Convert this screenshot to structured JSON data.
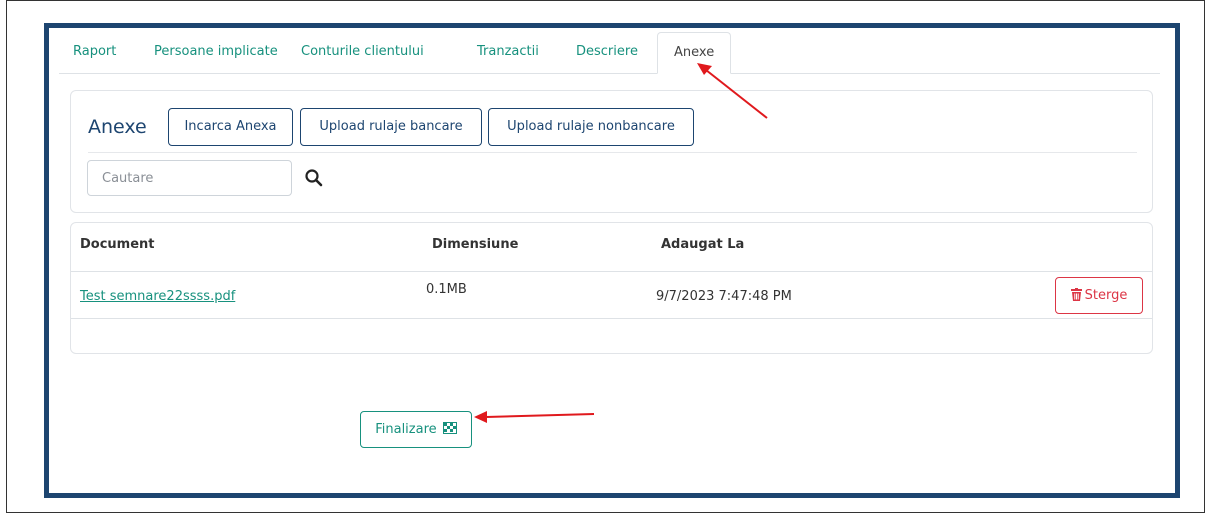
{
  "tabs": [
    {
      "label": "Raport",
      "active": false
    },
    {
      "label": "Persoane implicate",
      "active": false
    },
    {
      "label": "Conturile clientului",
      "active": false
    },
    {
      "label": "Tranzactii",
      "active": false
    },
    {
      "label": "Descriere",
      "active": false
    },
    {
      "label": "Anexe",
      "active": true
    }
  ],
  "anexe": {
    "title": "Anexe",
    "buttons": {
      "incarca": "Incarca Anexa",
      "upload_bancare": "Upload rulaje bancare",
      "upload_nonbancare": "Upload rulaje nonbancare"
    },
    "search": {
      "placeholder": "Cautare",
      "value": ""
    }
  },
  "table": {
    "headers": [
      "Document",
      "Dimensiune",
      "Adaugat La"
    ],
    "rows": [
      {
        "document": "Test semnare22ssss.pdf",
        "size": "0.1MB",
        "added": "9/7/2023 7:47:48 PM",
        "delete_label": "Sterge"
      }
    ]
  },
  "finalize": {
    "label": "Finalizare"
  },
  "colors": {
    "frame": "#1d4570",
    "accent": "#17917e",
    "danger": "#dc3545",
    "annotation_arrow": "#e0191d"
  },
  "icons": [
    "search-icon",
    "trash-icon",
    "checkered-flag-icon"
  ]
}
